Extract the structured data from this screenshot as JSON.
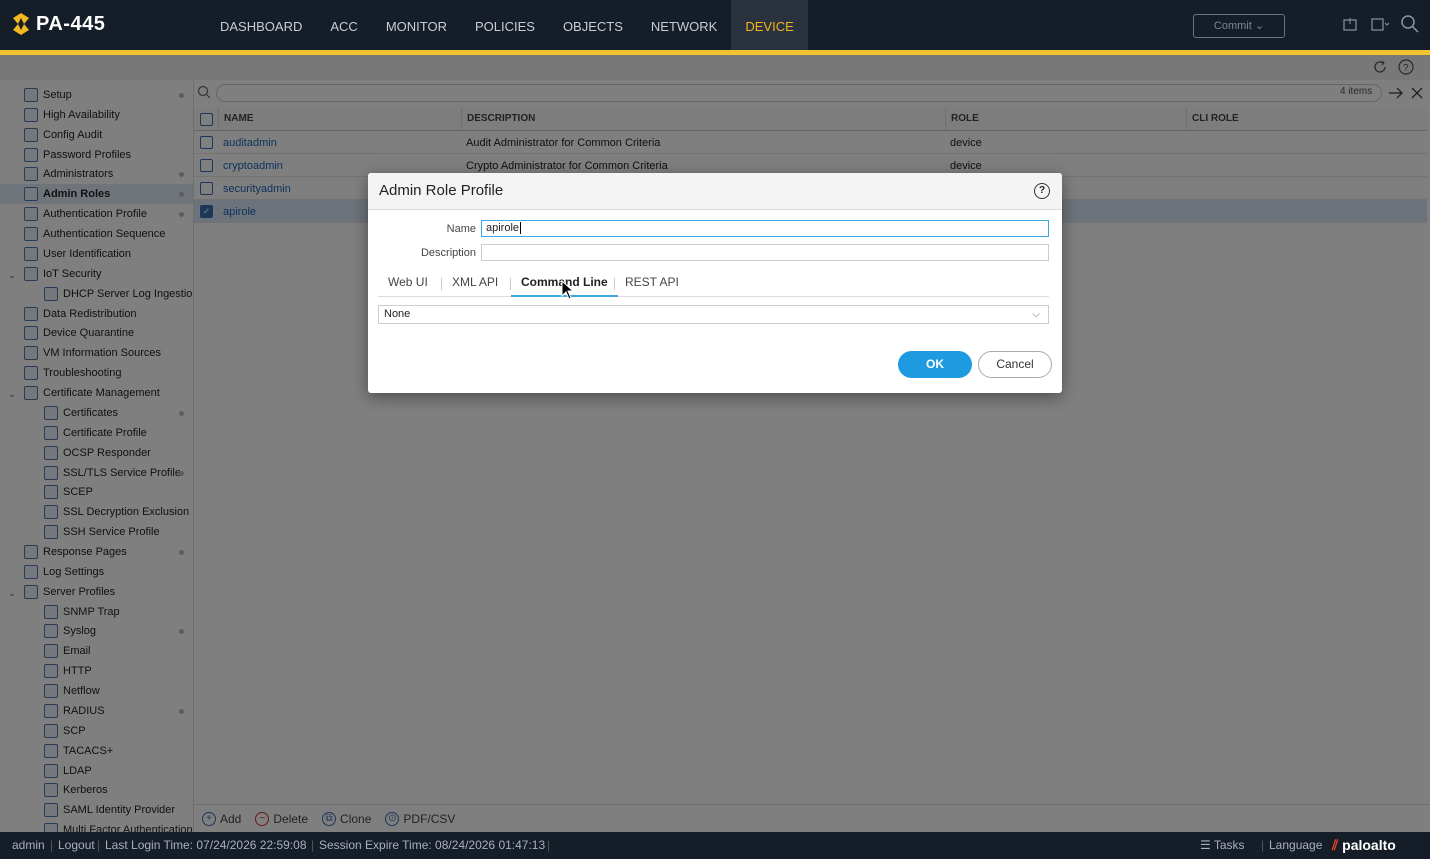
{
  "app": {
    "title": "PA-445"
  },
  "nav": [
    "DASHBOARD",
    "ACC",
    "MONITOR",
    "POLICIES",
    "OBJECTS",
    "NETWORK",
    "DEVICE"
  ],
  "nav_active": "DEVICE",
  "commit_label": "Commit",
  "sidebar": [
    {
      "label": "Setup",
      "indent": 0,
      "dot": true
    },
    {
      "label": "High Availability",
      "indent": 0
    },
    {
      "label": "Config Audit",
      "indent": 0
    },
    {
      "label": "Password Profiles",
      "indent": 0
    },
    {
      "label": "Administrators",
      "indent": 0,
      "dot": true
    },
    {
      "label": "Admin Roles",
      "indent": 0,
      "dot": true,
      "selected": true
    },
    {
      "label": "Authentication Profile",
      "indent": 0,
      "dot": true
    },
    {
      "label": "Authentication Sequence",
      "indent": 0
    },
    {
      "label": "User Identification",
      "indent": 0
    },
    {
      "label": "IoT Security",
      "indent": 0,
      "caret": true
    },
    {
      "label": "DHCP Server Log Ingestion",
      "indent": 1
    },
    {
      "label": "Data Redistribution",
      "indent": 0
    },
    {
      "label": "Device Quarantine",
      "indent": 0
    },
    {
      "label": "VM Information Sources",
      "indent": 0
    },
    {
      "label": "Troubleshooting",
      "indent": 0
    },
    {
      "label": "Certificate Management",
      "indent": 0,
      "caret": true
    },
    {
      "label": "Certificates",
      "indent": 1,
      "dot": true
    },
    {
      "label": "Certificate Profile",
      "indent": 1
    },
    {
      "label": "OCSP Responder",
      "indent": 1
    },
    {
      "label": "SSL/TLS Service Profile",
      "indent": 1,
      "dot": true
    },
    {
      "label": "SCEP",
      "indent": 1
    },
    {
      "label": "SSL Decryption Exclusion",
      "indent": 1
    },
    {
      "label": "SSH Service Profile",
      "indent": 1
    },
    {
      "label": "Response Pages",
      "indent": 0,
      "dot": true
    },
    {
      "label": "Log Settings",
      "indent": 0
    },
    {
      "label": "Server Profiles",
      "indent": 0,
      "caret": true
    },
    {
      "label": "SNMP Trap",
      "indent": 1
    },
    {
      "label": "Syslog",
      "indent": 1,
      "dot": true
    },
    {
      "label": "Email",
      "indent": 1
    },
    {
      "label": "HTTP",
      "indent": 1
    },
    {
      "label": "Netflow",
      "indent": 1
    },
    {
      "label": "RADIUS",
      "indent": 1,
      "dot": true
    },
    {
      "label": "SCP",
      "indent": 1
    },
    {
      "label": "TACACS+",
      "indent": 1
    },
    {
      "label": "LDAP",
      "indent": 1
    },
    {
      "label": "Kerberos",
      "indent": 1
    },
    {
      "label": "SAML Identity Provider",
      "indent": 1
    },
    {
      "label": "Multi Factor Authentication",
      "indent": 1
    }
  ],
  "table": {
    "items_count": "4 items",
    "columns": [
      "NAME",
      "DESCRIPTION",
      "ROLE",
      "CLI ROLE"
    ],
    "rows": [
      {
        "name": "auditadmin",
        "description": "Audit Administrator for Common Criteria",
        "role": "device",
        "cli_role": "",
        "checked": false
      },
      {
        "name": "cryptoadmin",
        "description": "Crypto Administrator for Common Criteria",
        "role": "device",
        "cli_role": "",
        "checked": false
      },
      {
        "name": "securityadmin",
        "description": "",
        "role": "",
        "cli_role": "",
        "checked": false
      },
      {
        "name": "apirole",
        "description": "",
        "role": "",
        "cli_role": "",
        "checked": true
      }
    ]
  },
  "footer_actions": [
    "Add",
    "Delete",
    "Clone",
    "PDF/CSV"
  ],
  "status": {
    "user": "admin",
    "logout": "Logout",
    "last_login": "Last Login Time: 07/24/2026 22:59:08",
    "session_expire": "Session Expire Time: 08/24/2026 01:47:13",
    "tasks": "Tasks",
    "language": "Language",
    "brand": "paloalto"
  },
  "modal": {
    "title": "Admin Role Profile",
    "name_label": "Name",
    "name_value": "apirole",
    "description_label": "Description",
    "description_value": "",
    "tabs": [
      "Web UI",
      "XML API",
      "Command Line",
      "REST API"
    ],
    "active_tab": "Command Line",
    "select_value": "None",
    "ok": "OK",
    "cancel": "Cancel"
  }
}
